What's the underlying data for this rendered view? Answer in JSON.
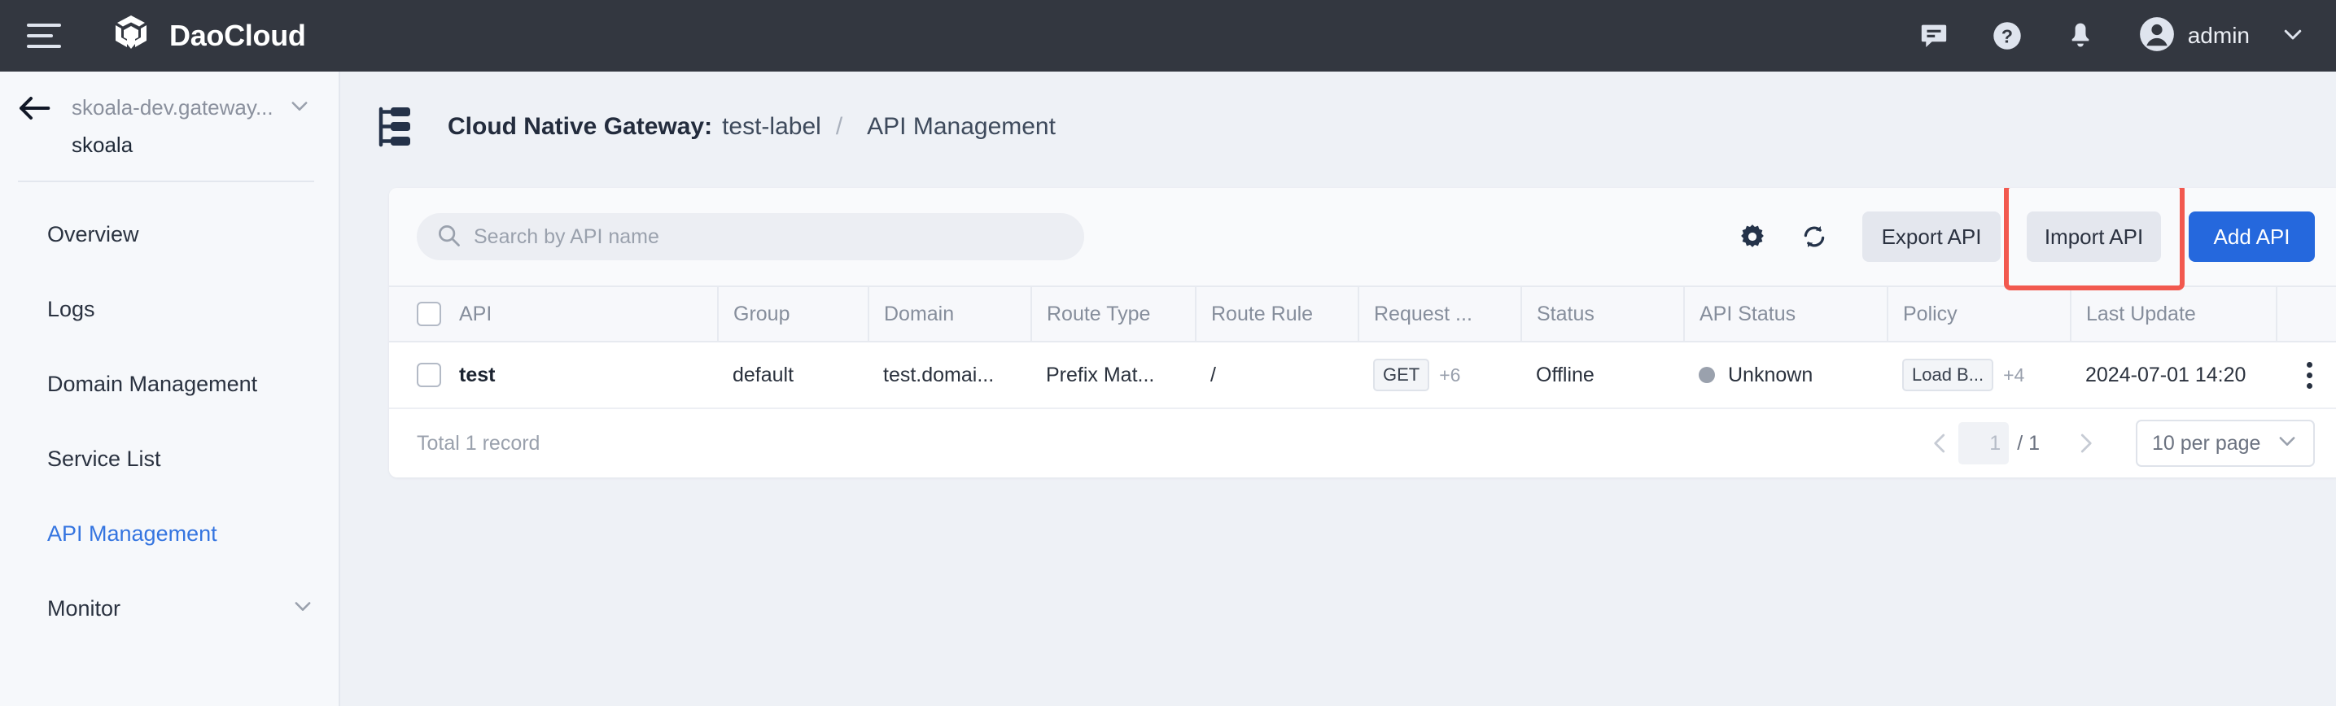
{
  "topbar": {
    "brand": "DaoCloud",
    "icons": [
      "menu-icon",
      "chat-icon",
      "help-icon",
      "bell-icon"
    ],
    "user": "admin"
  },
  "sidebar": {
    "project": "skoala-dev.gateway...",
    "namespace": "skoala",
    "items": [
      {
        "label": "Overview",
        "active": false,
        "expandable": false
      },
      {
        "label": "Logs",
        "active": false,
        "expandable": false
      },
      {
        "label": "Domain Management",
        "active": false,
        "expandable": false
      },
      {
        "label": "Service List",
        "active": false,
        "expandable": false
      },
      {
        "label": "API Management",
        "active": true,
        "expandable": false
      },
      {
        "label": "Monitor",
        "active": false,
        "expandable": true
      }
    ]
  },
  "breadcrumb": {
    "title": "Cloud Native Gateway:",
    "gateway": "test-label",
    "separator": "/",
    "page": "API Management"
  },
  "toolbar": {
    "search_placeholder": "Search by API name",
    "search_value": "",
    "export_label": "Export API",
    "import_label": "Import API",
    "add_label": "Add API"
  },
  "table": {
    "columns": [
      "API",
      "Group",
      "Domain",
      "Route Type",
      "Route Rule",
      "Request ...",
      "Status",
      "API Status",
      "Policy",
      "Last Update"
    ],
    "rows": [
      {
        "api": "test",
        "group": "default",
        "domain": "test.domai...",
        "route_type": "Prefix Mat...",
        "route_rule": "/",
        "request_method": "GET",
        "request_more": "+6",
        "status": "Offline",
        "api_status": "Unknown",
        "policy": "Load B...",
        "policy_more": "+4",
        "last_update": "2024-07-01 14:20"
      }
    ]
  },
  "footer": {
    "total": "Total 1 record",
    "page_value": "1",
    "page_total": "/ 1",
    "per_page": "10 per page"
  },
  "colors": {
    "accent": "#2568dd",
    "highlight": "#f2594f",
    "topbar_bg": "#333740",
    "sidebar_active": "#3575e0"
  }
}
